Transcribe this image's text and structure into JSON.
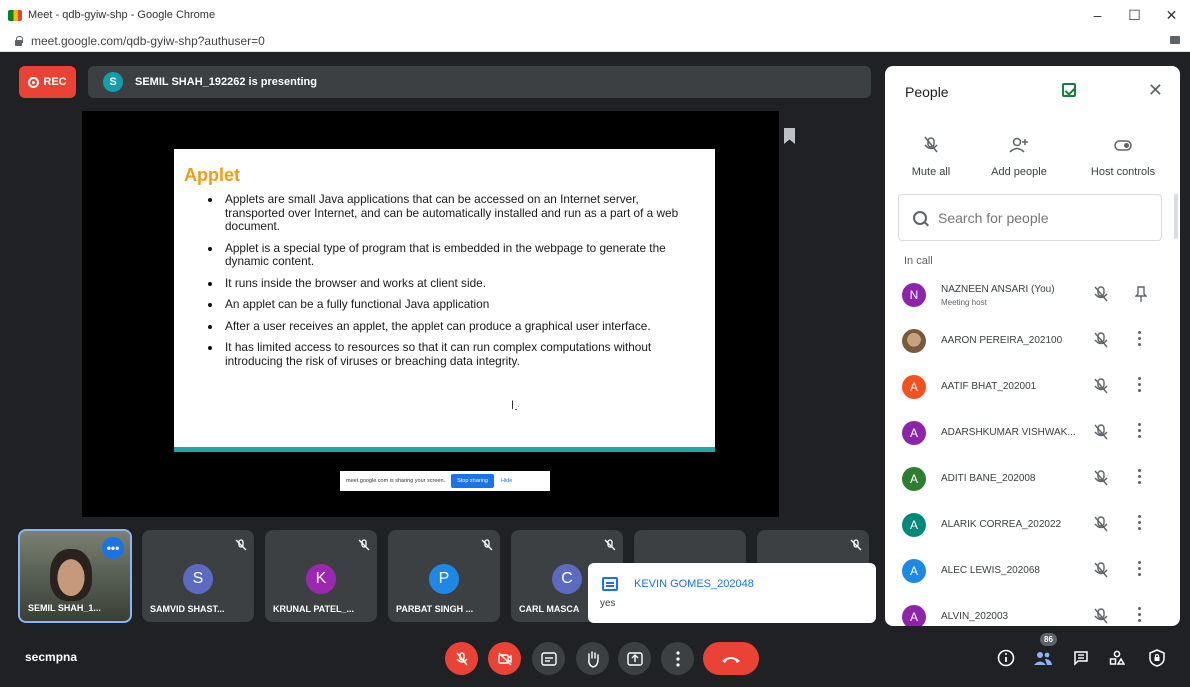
{
  "browser": {
    "window_title": "Meet - qdb-gyiw-shp - Google Chrome",
    "url": "meet.google.com/qdb-gyiw-shp?authuser=0",
    "controls": {
      "minimize": "–",
      "maximize": "☐",
      "close": "✕"
    }
  },
  "recording": {
    "label": "REC",
    "color": "#ea4335"
  },
  "presenter": {
    "initial": "S",
    "text": "SEMIL SHAH_192262 is presenting",
    "color": "#129eaf"
  },
  "slide": {
    "title": "Applet",
    "bullets": [
      "Applets are small Java applications that can be accessed on an Internet server, transported over Internet, and can be automatically installed and run as a part of a web document.",
      "Applet is a special type of program that is embedded in the webpage to generate the dynamic content.",
      "It runs inside the browser and works at client side.",
      "An applet can be a fully functional Java application",
      "After a user receives an applet, the applet can produce a graphical user interface.",
      "It has limited access to resources so that it can run complex computations without introducing the risk of viruses or breaching data integrity."
    ]
  },
  "share_bar": {
    "text": "meet.google.com is sharing your screen.",
    "stop_label": "Stop sharing",
    "hide_label": "Hide"
  },
  "tiles": [
    {
      "name": "SEMIL SHAH_1...",
      "initial": "",
      "color": ""
    },
    {
      "name": "SAMVID SHAST...",
      "initial": "S",
      "color": "#5c6bc0"
    },
    {
      "name": "KRUNAL PATEL_...",
      "initial": "K",
      "color": "#9c27b0"
    },
    {
      "name": "PARBAT SINGH ...",
      "initial": "P",
      "color": "#1e88e5"
    },
    {
      "name": "CARL MASCA",
      "initial": "C",
      "color": "#5c6bc0"
    }
  ],
  "chat": {
    "sender": "KEVIN GOMES_202048",
    "message": "yes"
  },
  "people": {
    "title": "People",
    "actions": {
      "mute_all": "Mute all",
      "add_people": "Add people",
      "host_controls": "Host controls"
    },
    "search_placeholder": "Search for people",
    "section_label": "In call",
    "list": [
      {
        "name": "NAZNEEN ANSARI (You)",
        "sub": "Meeting host",
        "initial": "N",
        "color": "#8e24aa"
      },
      {
        "name": "AARON PEREIRA_202100",
        "sub": "",
        "initial": "",
        "color": ""
      },
      {
        "name": "AATIF BHAT_202001",
        "sub": "",
        "initial": "A",
        "color": "#f4511e"
      },
      {
        "name": "ADARSHKUMAR VISHWAK...",
        "sub": "",
        "initial": "A",
        "color": "#8e24aa"
      },
      {
        "name": "ADITI BANE_202008",
        "sub": "",
        "initial": "A",
        "color": "#2e7d32"
      },
      {
        "name": "ALARIK CORREA_202022",
        "sub": "",
        "initial": "A",
        "color": "#00897b"
      },
      {
        "name": "ALEC LEWIS_202068",
        "sub": "",
        "initial": "A",
        "color": "#1e88e5"
      },
      {
        "name": "ALVIN_202003",
        "sub": "",
        "initial": "A",
        "color": "#8e24aa"
      }
    ]
  },
  "bottom": {
    "meeting_code": "secmpna",
    "participant_count": "86"
  }
}
